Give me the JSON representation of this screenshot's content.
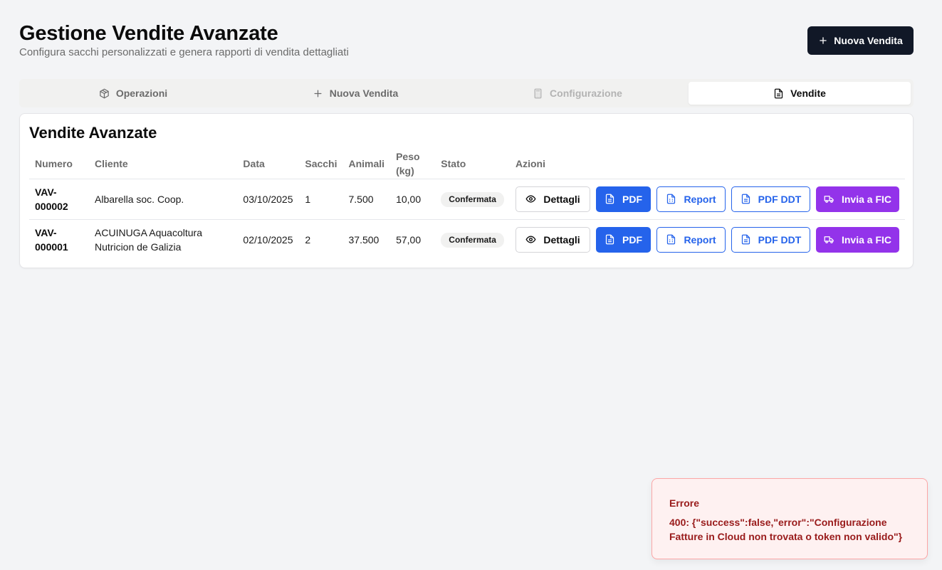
{
  "header": {
    "title": "Gestione Vendite Avanzate",
    "subtitle": "Configura sacchi personalizzati e genera rapporti di vendita dettagliati",
    "new_sale_button": "Nuova Vendita"
  },
  "tabs": [
    {
      "label": "Operazioni",
      "icon": "package-icon",
      "state": "normal"
    },
    {
      "label": "Nuova Vendita",
      "icon": "plus-icon",
      "state": "normal"
    },
    {
      "label": "Configurazione",
      "icon": "calculator-icon",
      "state": "disabled"
    },
    {
      "label": "Vendite",
      "icon": "document-icon",
      "state": "active"
    }
  ],
  "card": {
    "title": "Vendite Avanzate"
  },
  "table": {
    "columns": [
      "Numero",
      "Cliente",
      "Data",
      "Sacchi",
      "Animali",
      "Peso (kg)",
      "Stato",
      "Azioni"
    ],
    "rows": [
      {
        "numero": "VAV-000002",
        "cliente": "Albarella soc. Coop.",
        "data": "03/10/2025",
        "sacchi": "1",
        "animali": "7.500",
        "peso": "10,00",
        "stato": "Confermata"
      },
      {
        "numero": "VAV-000001",
        "cliente": "ACUINUGA Aquacoltura Nutricion de Galizia",
        "data": "02/10/2025",
        "sacchi": "2",
        "animali": "37.500",
        "peso": "57,00",
        "stato": "Confermata"
      }
    ],
    "actions": {
      "details": "Dettagli",
      "pdf": "PDF",
      "report": "Report",
      "pdf_ddt": "PDF DDT",
      "send_fic": "Invia a FIC"
    }
  },
  "toast": {
    "title": "Errore",
    "message": "400: {\"success\":false,\"error\":\"Configurazione Fatture in Cloud non trovata o token non valido\"}"
  },
  "colors": {
    "primary_dark": "#111827",
    "blue": "#2563eb",
    "purple": "#9333ea",
    "error_text": "#991b1b",
    "error_bg": "#fef1f1"
  }
}
